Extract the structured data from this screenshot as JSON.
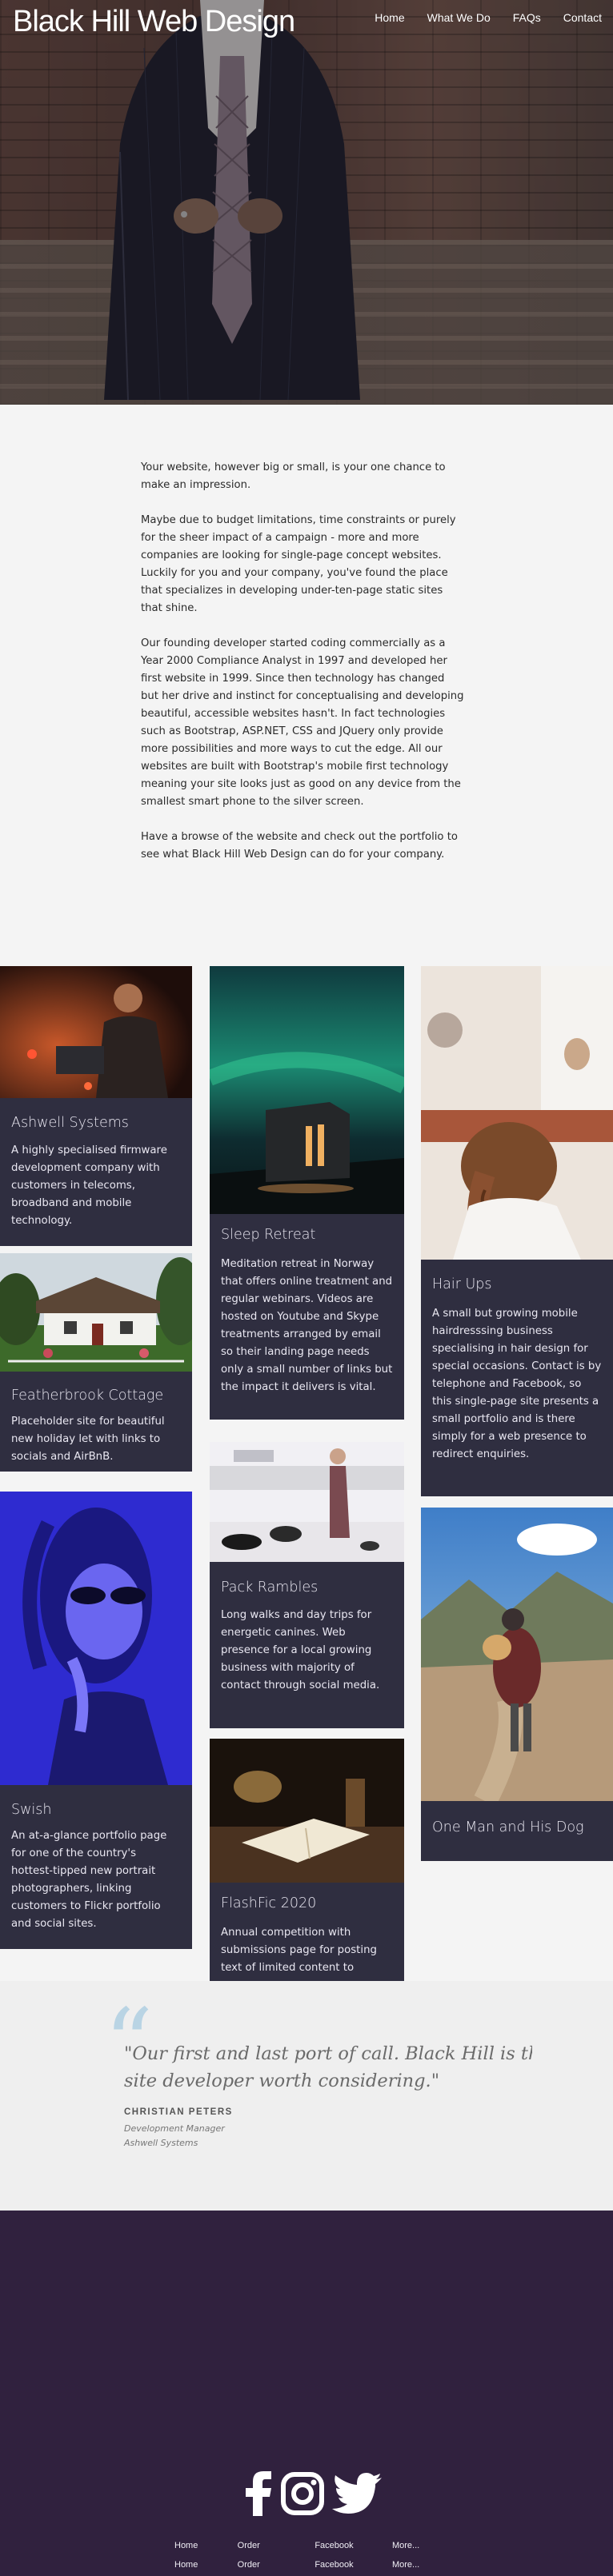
{
  "header": {
    "brand": "Black Hill Web Design",
    "nav": [
      "Home",
      "What We Do",
      "FAQs",
      "Contact"
    ]
  },
  "intro": {
    "paragraphs": [
      "Your website, however big or small, is your one chance to make an impression.",
      "Maybe due to budget limitations, time constraints or purely for the sheer impact of a campaign - more and more companies are looking for single-page concept websites. Luckily for you and your company, you've found the place that specializes in developing under-ten-page static sites that shine.",
      "Our founding developer started coding commercially as a Year 2000 Compliance Analyst in 1997 and developed her first website in 1999. Since then technology has changed but her drive and instinct for conceptualising and developing beautiful, accessible websites hasn't. In fact technologies such as Bootstrap, ASP.NET, CSS and JQuery only provide more possibilities and more ways to cut the edge. All our websites are built with Bootstrap's mobile first technology meaning your site looks just as good on any device from the smallest smart phone to the silver screen.",
      "Have a browse of the website and check out the portfolio to see what Black Hill Web Design can do for your company."
    ]
  },
  "portfolio": [
    {
      "title": "Ashwell Systems",
      "desc": "A highly specialised firmware development company with customers in telecoms, broadband and mobile technology."
    },
    {
      "title": "Featherbrook Cottage",
      "desc": "Placeholder site for beautiful new holiday let with links to socials and AirBnB."
    },
    {
      "title": "Swish",
      "desc": "An at-a-glance portfolio page for one of the country's hottest-tipped new portrait photographers, linking customers to Flickr portfolio and social sites."
    },
    {
      "title": "Sleep Retreat",
      "desc": "Meditation retreat in Norway that offers online treatment and regular webinars. Videos are hosted on Youtube and Skype treatments arranged by email so their landing page needs only a small number of links but the impact it delivers is vital."
    },
    {
      "title": "Pack Rambles",
      "desc": "Long walks and day trips for energetic canines. Web presence for a local growing business with majority of contact through social media."
    },
    {
      "title": "FlashFic 2020",
      "desc": "Annual competition with submissions page for posting text of limited content to"
    },
    {
      "title": "Hair Ups",
      "desc": "A small but growing mobile hairdresssing business specialising in hair design for special occasions. Contact is by telephone and Facebook, so this single-page site presents a small portfolio and is there simply for a web presence to redirect enquiries."
    },
    {
      "title": "One Man and His Dog",
      "desc": ""
    }
  ],
  "testimonial": {
    "quote_line1": "\"Our first and last port of call. Black Hill is the c",
    "quote_line2": "site developer worth considering.\"",
    "author": "CHRISTIAN PETERS",
    "role": "Development Manager",
    "company": "Ashwell Systems"
  },
  "footer": {
    "social_icons": [
      "facebook-icon",
      "instagram-icon",
      "twitter-icon"
    ],
    "row1": [
      "Home",
      "Order",
      "Facebook",
      "More..."
    ],
    "row2": [
      "Home",
      "Order",
      "Facebook",
      "More..."
    ]
  },
  "colors": {
    "card_bg": "#2f2e40",
    "footer_bg": "#30213e",
    "quote_mark": "#b9d4e4"
  }
}
